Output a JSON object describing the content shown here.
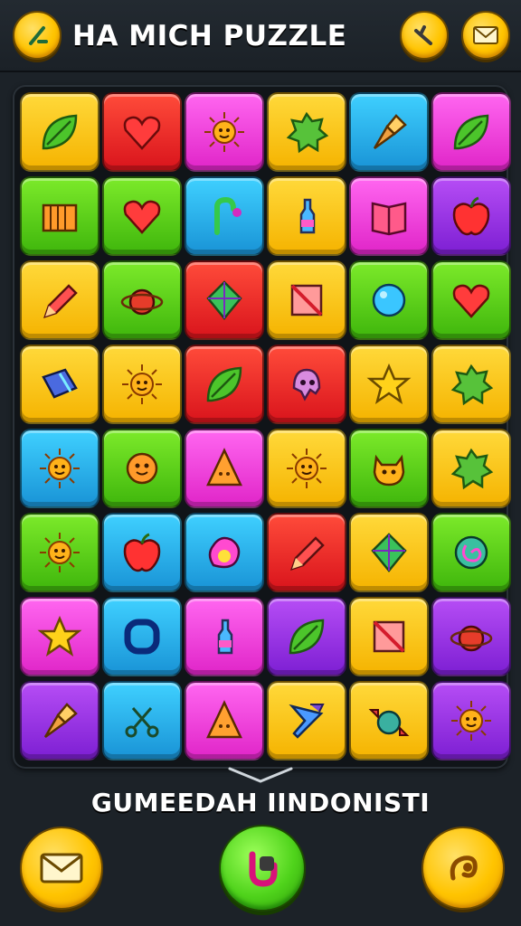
{
  "header": {
    "title": "HA MICH PUZZLE",
    "left_button_icon": "wand-icon",
    "right_buttons": [
      {
        "icon": "wand-icon"
      },
      {
        "icon": "envelope-icon"
      }
    ]
  },
  "board": {
    "rows": [
      [
        {
          "color": "yellow",
          "icon": "leaf"
        },
        {
          "color": "red",
          "icon": "heart"
        },
        {
          "color": "pink",
          "icon": "sun"
        },
        {
          "color": "yellow",
          "icon": "splat"
        },
        {
          "color": "blue",
          "icon": "cone"
        },
        {
          "color": "pink",
          "icon": "leaf"
        }
      ],
      [
        {
          "color": "green",
          "icon": "box"
        },
        {
          "color": "green",
          "icon": "heart"
        },
        {
          "color": "blue",
          "icon": "hook"
        },
        {
          "color": "yellow",
          "icon": "bottle"
        },
        {
          "color": "pink",
          "icon": "book"
        },
        {
          "color": "purple",
          "icon": "apple"
        }
      ],
      [
        {
          "color": "yellow",
          "icon": "pencil"
        },
        {
          "color": "green",
          "icon": "orb"
        },
        {
          "color": "red",
          "icon": "gem"
        },
        {
          "color": "yellow",
          "icon": "square"
        },
        {
          "color": "green",
          "icon": "bubble"
        },
        {
          "color": "green",
          "icon": "heart"
        }
      ],
      [
        {
          "color": "yellow",
          "icon": "eraser"
        },
        {
          "color": "yellow",
          "icon": "sun"
        },
        {
          "color": "red",
          "icon": "leaf"
        },
        {
          "color": "red",
          "icon": "ghost"
        },
        {
          "color": "yellow",
          "icon": "star"
        },
        {
          "color": "yellow",
          "icon": "splat"
        }
      ],
      [
        {
          "color": "blue",
          "icon": "sun"
        },
        {
          "color": "green",
          "icon": "face"
        },
        {
          "color": "pink",
          "icon": "triangle"
        },
        {
          "color": "yellow",
          "icon": "sun"
        },
        {
          "color": "green",
          "icon": "cat"
        },
        {
          "color": "yellow",
          "icon": "splat"
        }
      ],
      [
        {
          "color": "green",
          "icon": "sun"
        },
        {
          "color": "blue",
          "icon": "apple"
        },
        {
          "color": "blue",
          "icon": "blob"
        },
        {
          "color": "red",
          "icon": "pencil"
        },
        {
          "color": "yellow",
          "icon": "gem"
        },
        {
          "color": "green",
          "icon": "swirl"
        }
      ],
      [
        {
          "color": "pink",
          "icon": "star"
        },
        {
          "color": "blue",
          "icon": "ring"
        },
        {
          "color": "pink",
          "icon": "bottle"
        },
        {
          "color": "purple",
          "icon": "leaf"
        },
        {
          "color": "yellow",
          "icon": "square"
        },
        {
          "color": "purple",
          "icon": "orb"
        }
      ],
      [
        {
          "color": "purple",
          "icon": "cone"
        },
        {
          "color": "blue",
          "icon": "scissors"
        },
        {
          "color": "pink",
          "icon": "triangle"
        },
        {
          "color": "yellow",
          "icon": "funnel"
        },
        {
          "color": "yellow",
          "icon": "candy"
        },
        {
          "color": "purple",
          "icon": "sun"
        }
      ]
    ]
  },
  "footer": {
    "text": "GUMEEDAH IINDONISTI",
    "left_button_icon": "envelope-icon",
    "center_button_icon": "magnet-icon",
    "right_button_icon": "swirl-icon"
  }
}
